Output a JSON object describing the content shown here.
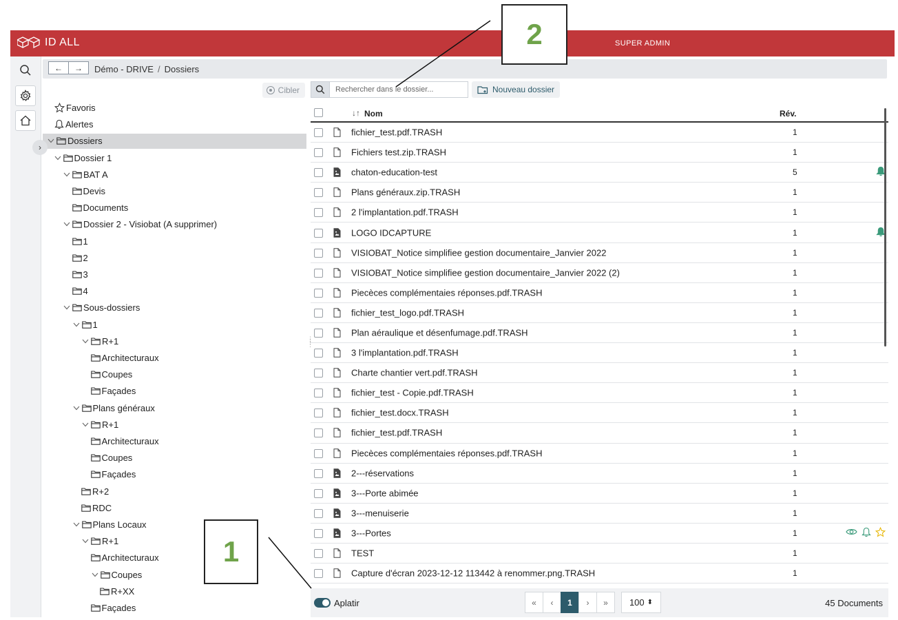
{
  "header": {
    "app_name": "ID ALL",
    "role": "SUPER ADMIN",
    "brand_color": "#c1373a"
  },
  "rail": {
    "items": [
      "search-icon",
      "gear-icon",
      "home-icon"
    ]
  },
  "breadcrumb": {
    "back": "←",
    "forward": "→",
    "items": [
      "Démo - DRIVE",
      "Dossiers"
    ],
    "separator": "/"
  },
  "tree": {
    "cibler_label": "Cibler",
    "nodes": [
      {
        "label": "Favoris",
        "depth": 0,
        "icon": "star-icon",
        "chevron": ""
      },
      {
        "label": "Alertes",
        "depth": 0,
        "icon": "bell-icon",
        "chevron": ""
      },
      {
        "label": "Dossiers",
        "depth": 0,
        "icon": "folder-icon",
        "chevron": "down",
        "selected": true
      },
      {
        "label": "Dossier 1",
        "depth": 1,
        "icon": "folder-icon",
        "chevron": "down"
      },
      {
        "label": "BAT A",
        "depth": 2,
        "icon": "folder-icon",
        "chevron": "down"
      },
      {
        "label": "Devis",
        "depth": 3,
        "icon": "folder-icon",
        "chevron": ""
      },
      {
        "label": "Documents",
        "depth": 3,
        "icon": "folder-icon",
        "chevron": ""
      },
      {
        "label": "Dossier 2 - Visiobat (A supprimer)",
        "depth": 2,
        "icon": "folder-icon",
        "chevron": "down"
      },
      {
        "label": "1",
        "depth": 3,
        "icon": "folder-icon",
        "chevron": ""
      },
      {
        "label": "2",
        "depth": 3,
        "icon": "folder-icon",
        "chevron": ""
      },
      {
        "label": "3",
        "depth": 3,
        "icon": "folder-icon",
        "chevron": ""
      },
      {
        "label": "4",
        "depth": 3,
        "icon": "folder-icon",
        "chevron": ""
      },
      {
        "label": "Sous-dossiers",
        "depth": 2,
        "icon": "folder-icon",
        "chevron": "down"
      },
      {
        "label": "1",
        "depth": 3,
        "icon": "folder-icon",
        "chevron": "down"
      },
      {
        "label": "R+1",
        "depth": 4,
        "icon": "folder-icon",
        "chevron": "down"
      },
      {
        "label": "Architecturaux",
        "depth": 5,
        "icon": "folder-icon",
        "chevron": ""
      },
      {
        "label": "Coupes",
        "depth": 5,
        "icon": "folder-icon",
        "chevron": ""
      },
      {
        "label": "Façades",
        "depth": 5,
        "icon": "folder-icon",
        "chevron": ""
      },
      {
        "label": "Plans généraux",
        "depth": 3,
        "icon": "folder-icon",
        "chevron": "down"
      },
      {
        "label": "R+1",
        "depth": 4,
        "icon": "folder-icon",
        "chevron": "down"
      },
      {
        "label": "Architecturaux",
        "depth": 5,
        "icon": "folder-icon",
        "chevron": ""
      },
      {
        "label": "Coupes",
        "depth": 5,
        "icon": "folder-icon",
        "chevron": ""
      },
      {
        "label": "Façades",
        "depth": 5,
        "icon": "folder-icon",
        "chevron": ""
      },
      {
        "label": "R+2",
        "depth": 4,
        "icon": "folder-icon",
        "chevron": ""
      },
      {
        "label": "RDC",
        "depth": 4,
        "icon": "folder-icon",
        "chevron": ""
      },
      {
        "label": "Plans Locaux",
        "depth": 3,
        "icon": "folder-icon",
        "chevron": "down"
      },
      {
        "label": "R+1",
        "depth": 4,
        "icon": "folder-icon",
        "chevron": "down"
      },
      {
        "label": "Architecturaux",
        "depth": 5,
        "icon": "folder-icon",
        "chevron": ""
      },
      {
        "label": "Coupes",
        "depth": 5,
        "icon": "folder-icon",
        "chevron": "down"
      },
      {
        "label": "R+XX",
        "depth": 6,
        "icon": "folder-icon",
        "chevron": ""
      },
      {
        "label": "Façades",
        "depth": 5,
        "icon": "folder-icon",
        "chevron": ""
      }
    ]
  },
  "toolbar": {
    "search_placeholder": "Rechercher dans le dossier...",
    "new_folder_label": "Nouveau dossier"
  },
  "table": {
    "columns": {
      "name": "Nom",
      "rev": "Rév.",
      "sort_glyph": "↓↑"
    },
    "rows": [
      {
        "name": "fichier_test.pdf.TRASH",
        "rev": "1",
        "type": "file",
        "actions": []
      },
      {
        "name": "Fichiers test.zip.TRASH",
        "rev": "1",
        "type": "file",
        "actions": []
      },
      {
        "name": "chaton-education-test",
        "rev": "5",
        "type": "image",
        "actions": [
          "bell-filled"
        ]
      },
      {
        "name": "Plans généraux.zip.TRASH",
        "rev": "1",
        "type": "file",
        "actions": []
      },
      {
        "name": "2 l'implantation.pdf.TRASH",
        "rev": "1",
        "type": "file",
        "actions": []
      },
      {
        "name": "LOGO IDCAPTURE",
        "rev": "1",
        "type": "image",
        "actions": [
          "bell-filled"
        ]
      },
      {
        "name": "VISIOBAT_Notice simplifiee gestion documentaire_Janvier 2022",
        "rev": "1",
        "type": "file",
        "actions": []
      },
      {
        "name": "VISIOBAT_Notice simplifiee gestion documentaire_Janvier 2022 (2)",
        "rev": "1",
        "type": "file",
        "actions": []
      },
      {
        "name": "Piecèces complémentaies réponses.pdf.TRASH",
        "rev": "1",
        "type": "file",
        "actions": []
      },
      {
        "name": "fichier_test_logo.pdf.TRASH",
        "rev": "1",
        "type": "file",
        "actions": []
      },
      {
        "name": "Plan aéraulique et désenfumage.pdf.TRASH",
        "rev": "1",
        "type": "file",
        "actions": []
      },
      {
        "name": "3 l'implantation.pdf.TRASH",
        "rev": "1",
        "type": "file",
        "actions": []
      },
      {
        "name": "Charte chantier vert.pdf.TRASH",
        "rev": "1",
        "type": "file",
        "actions": []
      },
      {
        "name": "fichier_test - Copie.pdf.TRASH",
        "rev": "1",
        "type": "file",
        "actions": []
      },
      {
        "name": "fichier_test.docx.TRASH",
        "rev": "1",
        "type": "file",
        "actions": []
      },
      {
        "name": "fichier_test.pdf.TRASH",
        "rev": "1",
        "type": "file",
        "actions": []
      },
      {
        "name": "Piecèces complémentaies réponses.pdf.TRASH",
        "rev": "1",
        "type": "file",
        "actions": []
      },
      {
        "name": "2---réservations",
        "rev": "1",
        "type": "image",
        "actions": []
      },
      {
        "name": "3---Porte abimée",
        "rev": "1",
        "type": "image",
        "actions": []
      },
      {
        "name": "3---menuiserie",
        "rev": "1",
        "type": "image",
        "actions": []
      },
      {
        "name": "3---Portes",
        "rev": "1",
        "type": "image",
        "actions": [
          "eye",
          "bell-outline",
          "star-outline"
        ]
      },
      {
        "name": "TEST",
        "rev": "1",
        "type": "file",
        "actions": []
      },
      {
        "name": "Capture d'écran 2023-12-12 113442 à renommer.png.TRASH",
        "rev": "1",
        "type": "file",
        "actions": []
      }
    ]
  },
  "footer": {
    "toggle_label": "Aplatir",
    "toggle_on": true,
    "pager": [
      "«",
      "‹",
      "1",
      "›",
      "»"
    ],
    "current_page": "1",
    "per_page": "100",
    "per_page_glyph": "⬍",
    "doc_count": "45 Documents"
  },
  "callouts": [
    {
      "label": "1"
    },
    {
      "label": "2"
    }
  ],
  "colors": {
    "accent": "#2d5b6b",
    "alert": "#3a9a7a",
    "star": "#e7b500",
    "callout_text": "#6fa34a"
  }
}
